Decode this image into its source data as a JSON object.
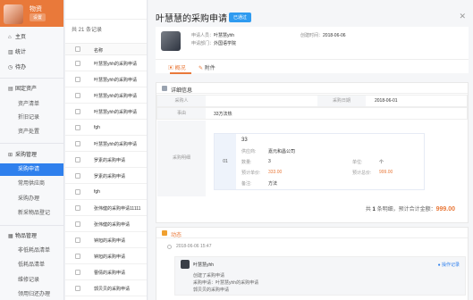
{
  "sidebar": {
    "app_name": "物资",
    "badge": "设置",
    "items": [
      {
        "label": "主页",
        "icon": "home-icon",
        "glyph": "⌂"
      },
      {
        "label": "统计",
        "icon": "chart-icon",
        "glyph": "▥"
      },
      {
        "label": "待办",
        "icon": "todo-icon",
        "glyph": "◷"
      }
    ],
    "group_assets": {
      "label": "固定资产",
      "glyph": "▤"
    },
    "assets_sub": [
      "资产清单",
      "折旧记录",
      "资产处置"
    ],
    "group_purchase": {
      "label": "采购管理",
      "glyph": "⊞"
    },
    "purchase_sub": [
      "采购申请",
      "常用供应商",
      "采购办理",
      "新采物品登记"
    ],
    "group_goods": {
      "label": "物品管理",
      "glyph": "▦"
    },
    "goods_sub": [
      "非低耗品清单",
      "低耗品清单",
      "维修记录",
      "领用归还办理"
    ]
  },
  "list": {
    "count_text": "共 21 条记录",
    "column_header": "名称",
    "rows": [
      "叶慧慧yhh的采购申请",
      "叶慧慧yhh的采购申请",
      "叶慧慧yhh的采购申请",
      "叶慧慧yhh的采购申请",
      "fgh",
      "叶慧慧yhh的采购申请",
      "罗素的采购申请",
      "罗素的采购申请",
      "fgh",
      "张伟健的采购申请11111",
      "张伟健的采购申请",
      "钟旭的采购申请",
      "钟旭的采购申请",
      "曹倩的采购申请",
      "郭贝贝的采购申请",
      "郭贝贝的采购申请"
    ]
  },
  "detail": {
    "title": "叶慧慧的采购申请",
    "status": "已通过",
    "applicant_label": "申请人员：",
    "applicant_value": "叶慧慧yhh",
    "dept_label": "申请部门：",
    "dept_value": "外国语学院",
    "created_label": "创建时间：",
    "created_value": "2018-06-06",
    "tabs": [
      "概况",
      "附件"
    ],
    "section_title": "详细信息",
    "grid": {
      "buyer_label": "采购人",
      "buyer_value": "",
      "date_label": "采购日期",
      "date_value": "2018-06-01",
      "reason_label": "事由",
      "reason_value": "33方法热",
      "detail_label": "采购明细"
    },
    "item": {
      "index": "01",
      "name": "33",
      "supplier_label": "供应商:",
      "supplier_value": "嘉元和昌公司",
      "qty_label": "数量:",
      "qty_value": "3",
      "unit_label": "单位:",
      "unit_value": "个",
      "price_label": "预计单价:",
      "price_value": "333.00",
      "total_label": "预计总价:",
      "total_value": "999.00",
      "note_label": "备注:",
      "note_value": "方法"
    },
    "summary_prefix": "共",
    "summary_count": "1",
    "summary_middle": "条明细，预计合计金额：",
    "summary_total": "999.00",
    "activity_title": "动态",
    "activity_time": "2018-06-06 15:47",
    "activity_user": "叶慧慧yhh",
    "activity_action": "操作记录",
    "activity_lines": [
      "创建了采购申请",
      "采购申请：叶慧慧yhh的采购申请",
      "郭贝贝的采购申请"
    ]
  },
  "colors": {
    "accent": "#e9793a",
    "primary": "#2f80ed",
    "status": "#2f9bf0"
  }
}
